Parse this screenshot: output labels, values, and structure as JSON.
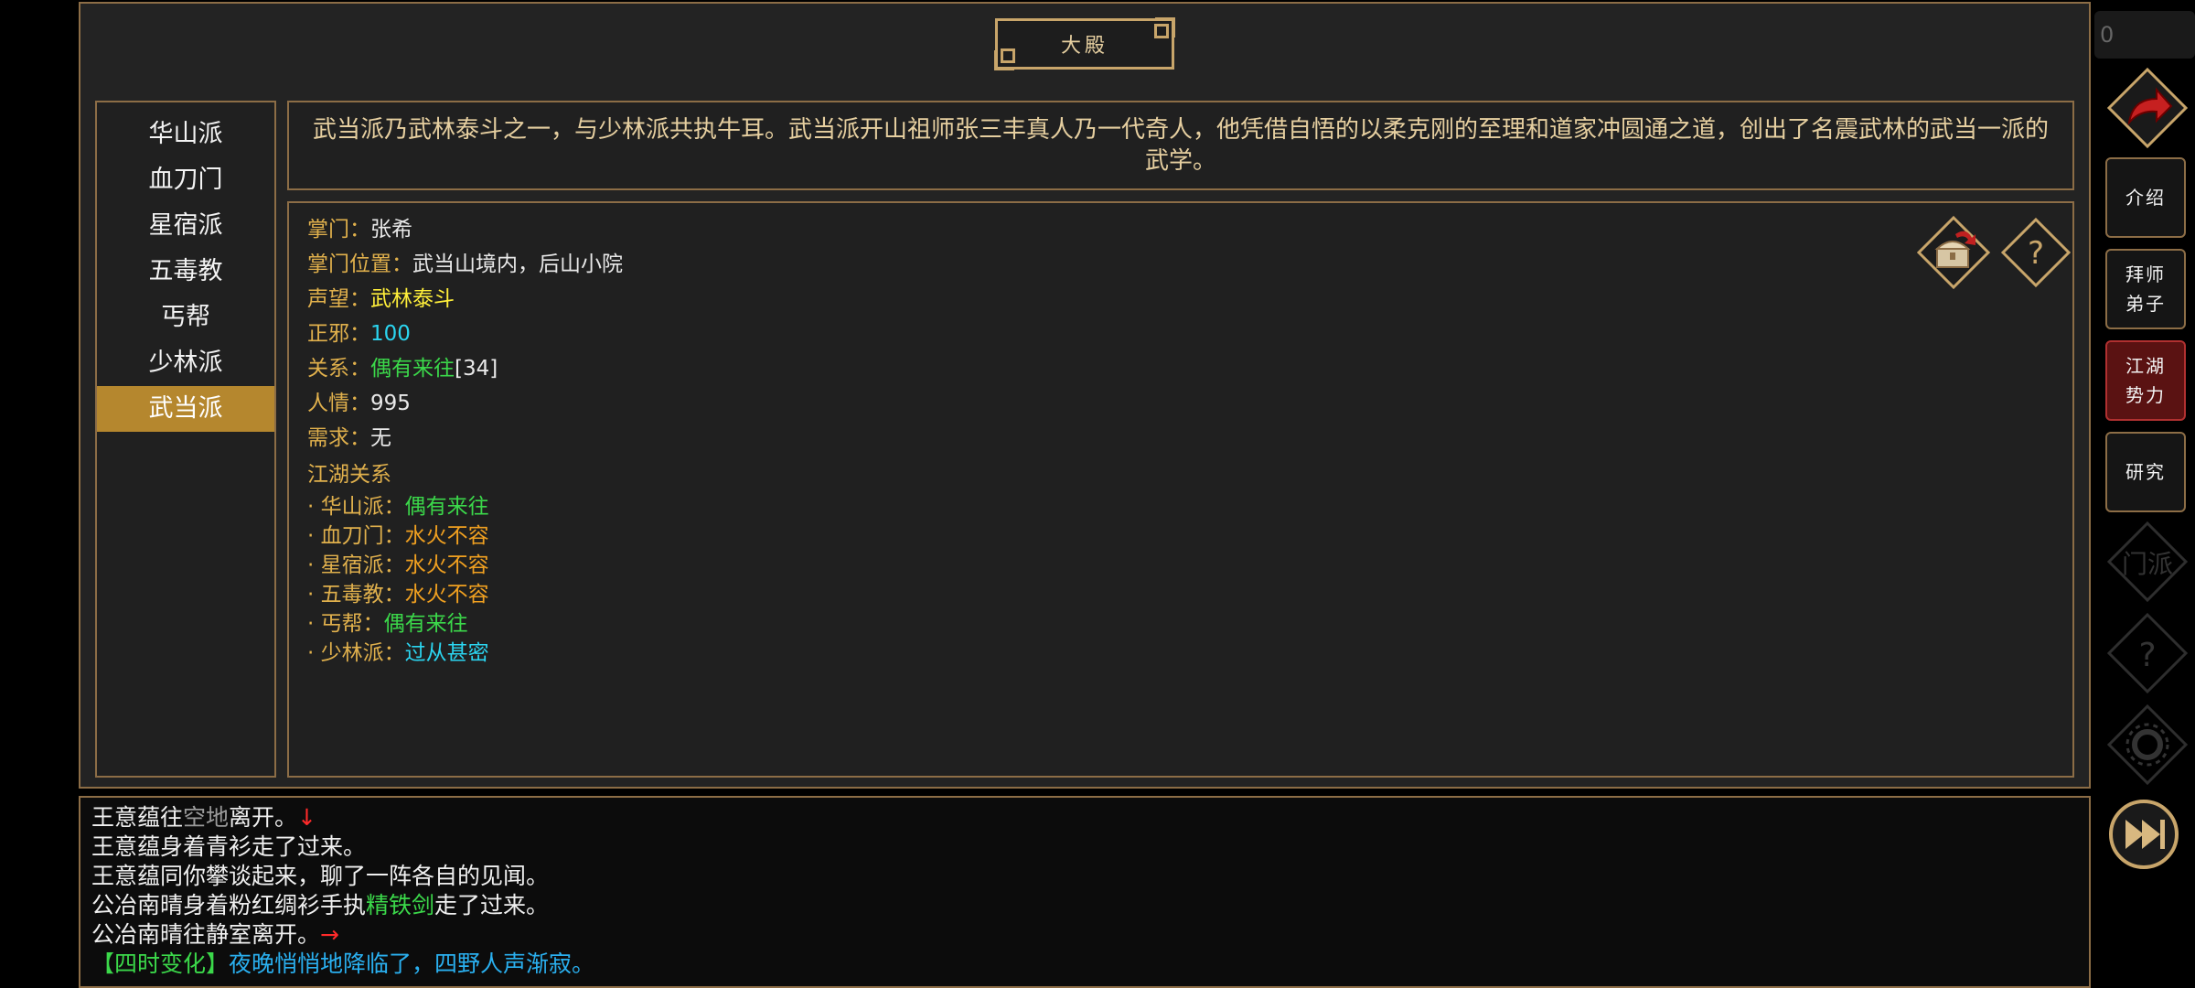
{
  "header": {
    "title": "大殿",
    "score_partial": "0"
  },
  "sects": [
    {
      "label": "华山派",
      "active": false
    },
    {
      "label": "血刀门",
      "active": false
    },
    {
      "label": "星宿派",
      "active": false
    },
    {
      "label": "五毒教",
      "active": false
    },
    {
      "label": "丐帮",
      "active": false
    },
    {
      "label": "少林派",
      "active": false
    },
    {
      "label": "武当派",
      "active": true
    }
  ],
  "intro": {
    "text": "武当派乃武林泰斗之一，与少林派共执牛耳。武当派开山祖师张三丰真人乃一代奇人，他凭借自悟的以柔克刚的至理和道家冲圆通之道，创出了名震武林的武当一派的武学。"
  },
  "detail": {
    "leader_label": "掌门：",
    "leader": "张希",
    "location_label": "掌门位置：",
    "location": "武当山境内，后山小院",
    "fame_label": "声望：",
    "fame": "武林泰斗",
    "alignment_label": "正邪：",
    "alignment": "100",
    "relation_label": "关系：",
    "relation": "偶有来往",
    "relation_value": "[34]",
    "favor_label": "人情：",
    "favor": "995",
    "need_label": "需求：",
    "need": "无",
    "jianghu_title": "江湖关系",
    "relations": [
      {
        "sect": "· 华山派：",
        "status": "偶有来往",
        "color": "green"
      },
      {
        "sect": "· 血刀门：",
        "status": "水火不容",
        "color": "orange"
      },
      {
        "sect": "· 星宿派：",
        "status": "水火不容",
        "color": "orange"
      },
      {
        "sect": "· 五毒教：",
        "status": "水火不容",
        "color": "orange"
      },
      {
        "sect": "· 丐帮：",
        "status": "偶有来往",
        "color": "green"
      },
      {
        "sect": "· 少林派：",
        "status": "过从甚密",
        "color": "cyan"
      }
    ]
  },
  "side_menu": {
    "intro": "介绍",
    "apprentice_1": "拜师",
    "apprentice_2": "弟子",
    "jianghu_1": "江湖",
    "jianghu_2": "势力",
    "research": "研究",
    "faded_sect": "门派"
  },
  "log": [
    {
      "parts": [
        {
          "t": "王意蕴往",
          "c": ""
        },
        {
          "t": "空地",
          "c": "gray"
        },
        {
          "t": "离开。",
          "c": ""
        },
        {
          "t": "↓",
          "c": "red"
        }
      ]
    },
    {
      "parts": [
        {
          "t": "王意蕴身着青衫走了过来。",
          "c": ""
        }
      ]
    },
    {
      "parts": [
        {
          "t": "王意蕴同你攀谈起来，聊了一阵各自的见闻。",
          "c": ""
        }
      ]
    },
    {
      "parts": [
        {
          "t": "公冶南晴身着粉红绸衫手执",
          "c": ""
        },
        {
          "t": "精铁剑",
          "c": "green"
        },
        {
          "t": "走了过来。",
          "c": ""
        }
      ]
    },
    {
      "parts": [
        {
          "t": "公冶南晴往静室离开。",
          "c": ""
        },
        {
          "t": "→",
          "c": "red"
        }
      ]
    },
    {
      "parts": [
        {
          "t": "【四时变化】",
          "c": "green"
        },
        {
          "t": "夜晚悄悄地降临了，四野人声渐寂。",
          "c": "blue"
        }
      ]
    }
  ],
  "colors": {
    "gold": "#c8a56a",
    "active_sect": "#b5872e",
    "active_side": "#5a1212"
  }
}
